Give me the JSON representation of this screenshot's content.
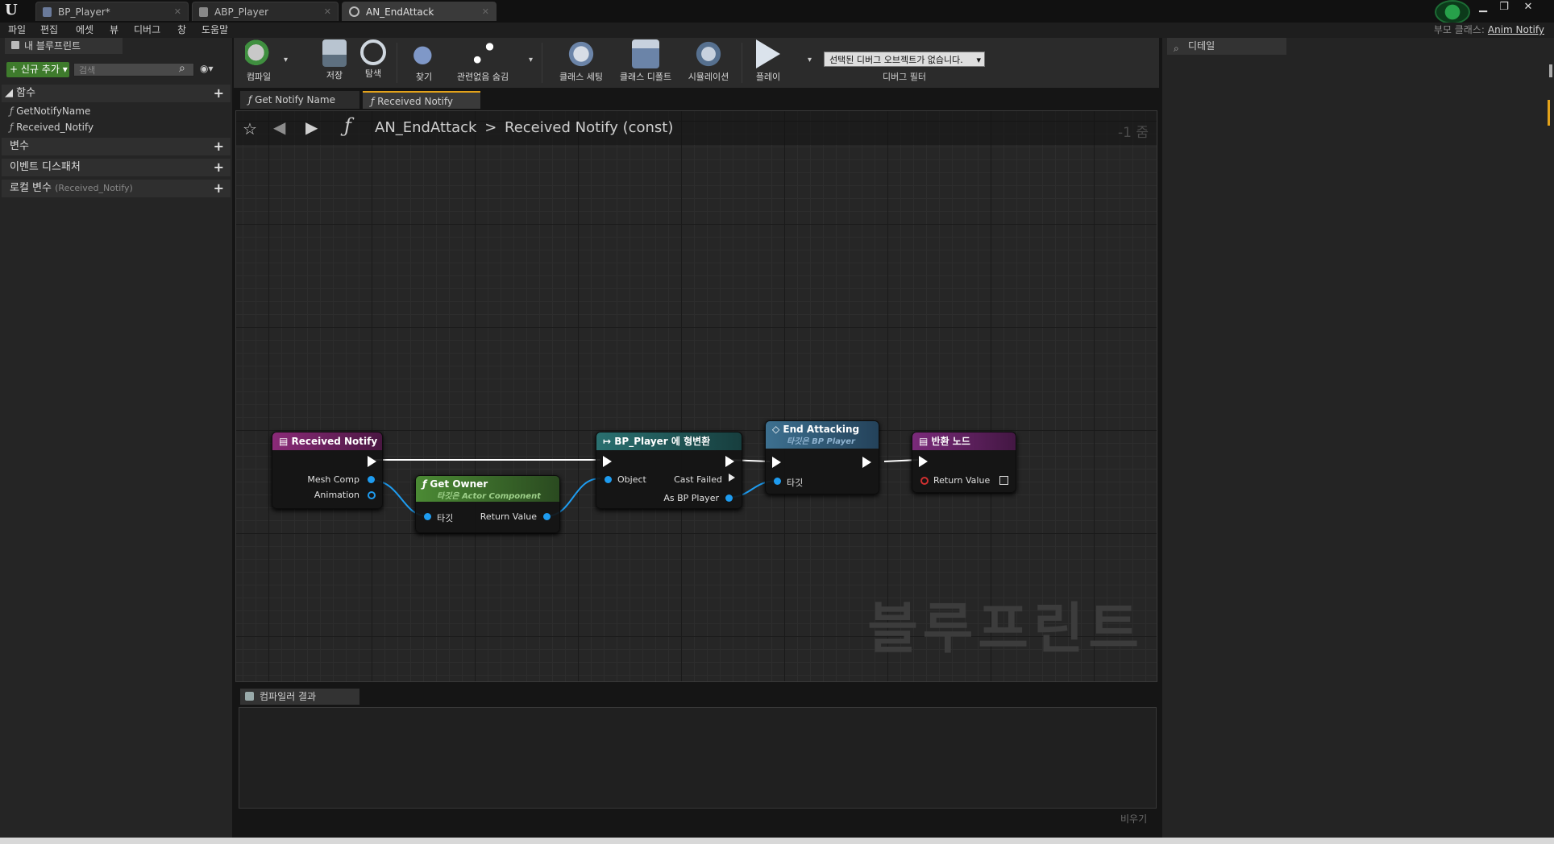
{
  "titlebar": {
    "tabs": [
      {
        "label": "BP_Player*"
      },
      {
        "label": "ABP_Player"
      },
      {
        "label": "AN_EndAttack"
      }
    ]
  },
  "menu": [
    "파일",
    "편집",
    "에셋",
    "뷰",
    "디버그",
    "창",
    "도움말"
  ],
  "parent_class": {
    "label": "부모 클래스:",
    "value": "Anim Notify"
  },
  "left_panel": {
    "tab": "내 블루프린트",
    "add_button": "신규 추가",
    "search_placeholder": "검색",
    "categories": {
      "functions": "함수",
      "variables": "변수",
      "dispatchers": "이벤트 디스패처",
      "local_vars": "로컬 변수",
      "local_vars_scope": "(Received_Notify)"
    },
    "functions": [
      "GetNotifyName",
      "Received_Notify"
    ]
  },
  "toolbar": {
    "compile": "컴파일",
    "save": "저장",
    "browse": "탐색",
    "find": "찾기",
    "hide_unrelated": "관련없음 숨김",
    "class_settings": "클래스 세팅",
    "class_defaults": "클래스 디폴트",
    "simulation": "시뮬레이션",
    "play": "플레이",
    "debug_select": "선택된 디버그 오브젝트가 없습니다.",
    "debug_filter": "디버그 필터"
  },
  "graph_tabs": [
    "Get Notify Name",
    "Received Notify"
  ],
  "graph": {
    "breadcrumb_root": "AN_EndAttack",
    "breadcrumb_leaf": "Received Notify (const)",
    "zoom": "-1 줌",
    "watermark": "블루프린트",
    "nodes": {
      "received_notify": {
        "title": "Received Notify",
        "pins": [
          "Mesh Comp",
          "Animation"
        ]
      },
      "get_owner": {
        "title": "Get Owner",
        "subtitle": "타깃은 Actor Component",
        "pins": [
          "타깃",
          "Return Value"
        ]
      },
      "cast": {
        "title": "BP_Player 에 형변환",
        "pins": [
          "Object",
          "Cast Failed",
          "As BP Player"
        ]
      },
      "end_attacking": {
        "title": "End Attacking",
        "subtitle": "타깃은 BP Player",
        "pins": [
          "타깃"
        ]
      },
      "return_node": {
        "title": "반환 노드",
        "pins": [
          "Return Value"
        ]
      }
    }
  },
  "compiler": {
    "tab": "컴파일러 결과",
    "clear": "비우기"
  },
  "details": {
    "tab": "디테일"
  },
  "colors": {
    "event_header": "#6d1e5e",
    "pure_header": "#3b6b2a",
    "cast_header": "#1f5e5e",
    "function_header": "#3d6a8a",
    "return_header": "#6a1f6a",
    "object_pin": "#1e9cf0",
    "accent": "#e3a21a"
  }
}
